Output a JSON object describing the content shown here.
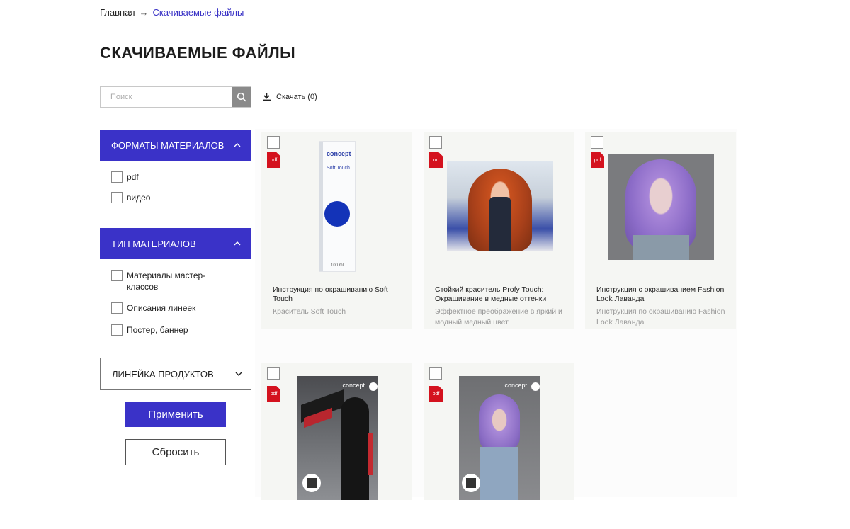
{
  "breadcrumb": {
    "home": "Главная",
    "arrow": "→",
    "current": "Скачиваемые файлы"
  },
  "page_title": "СКАЧИВАЕМЫЕ ФАЙЛЫ",
  "search": {
    "placeholder": "Поиск"
  },
  "download": {
    "label": "Скачать (0)"
  },
  "filters": {
    "formats": {
      "title": "ФОРМАТЫ МАТЕРИАЛОВ",
      "items": [
        "pdf",
        "видео"
      ]
    },
    "types": {
      "title": "ТИП МАТЕРИАЛОВ",
      "items": [
        "Материалы мастер-классов",
        "Описания линеек",
        "Постер, баннер"
      ]
    },
    "product_line": {
      "title": "ЛИНЕЙКА ПРОДУКТОВ"
    }
  },
  "buttons": {
    "apply": "Применить",
    "reset": "Сбросить"
  },
  "cards": [
    {
      "tag": "pdf",
      "title": "Инструкция по окрашиванию Soft Touch",
      "desc": "Краситель Soft Touch",
      "brand": "concept",
      "product": "Soft Touch",
      "volume": "100 ml"
    },
    {
      "tag": "url",
      "title": "Стойкий краситель Profy Touch: Окрашивание в медные оттенки",
      "desc": "Эффектное преображение в яркий и модный медный цвет"
    },
    {
      "tag": "pdf",
      "title": "Инструкция с окрашиванием Fashion Look Лаванда",
      "desc": "Инструкция по окрашиванию Fashion Look Лаванда"
    },
    {
      "tag": "pdf",
      "title": "",
      "desc": "",
      "brand": "concept"
    },
    {
      "tag": "pdf",
      "title": "",
      "desc": "",
      "brand": "concept"
    }
  ],
  "colors": {
    "accent": "#3a32c8",
    "pdf_tag": "#d4121e",
    "link": "#3b34c6"
  }
}
